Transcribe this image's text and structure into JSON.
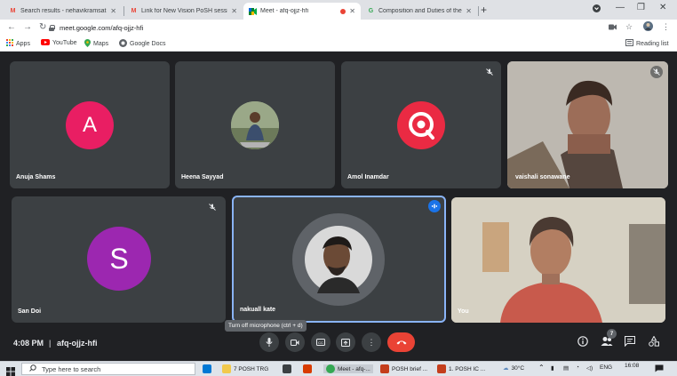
{
  "browser": {
    "tabs": [
      {
        "title": "Search results - nehavikramsathe",
        "icon": "gmail-icon"
      },
      {
        "title": "Link for New Vision PoSH session",
        "icon": "gmail-icon"
      },
      {
        "title": "Meet - afq-ojjz-hfi",
        "icon": "meet-icon",
        "active": true
      },
      {
        "title": "Composition and Duties of the In",
        "icon": "google-icon"
      }
    ],
    "new_tab": "+",
    "url": "meet.google.com/afq-ojjz-hfi",
    "bookmarks": [
      "Apps",
      "YouTube",
      "Maps",
      "Google Docs"
    ],
    "reading_list": "Reading list"
  },
  "meet": {
    "participants": [
      {
        "name": "Anuja Shams",
        "initial": "A",
        "color": "#e91e63"
      },
      {
        "name": "Heena Sayyad"
      },
      {
        "name": "Amol Inamdar"
      },
      {
        "name": "vaishali sonawane"
      },
      {
        "name": "San Doi",
        "initial": "S",
        "color": "#9c27b0"
      },
      {
        "name": "nakuall kate"
      },
      {
        "name": "You"
      }
    ],
    "time": "4:08 PM",
    "separator": "|",
    "meeting_code": "afq-ojjz-hfi",
    "tooltip": "Turn off microphone (ctrl + d)",
    "participant_count": "7"
  },
  "taskbar": {
    "search_placeholder": "Type here to search",
    "items": [
      "7 POSH TRG",
      "Meet - afq-...",
      "POSH brief ...",
      "1. POSH IC ..."
    ],
    "temperature": "30°C",
    "language": "ENG",
    "clock": "16:08"
  }
}
